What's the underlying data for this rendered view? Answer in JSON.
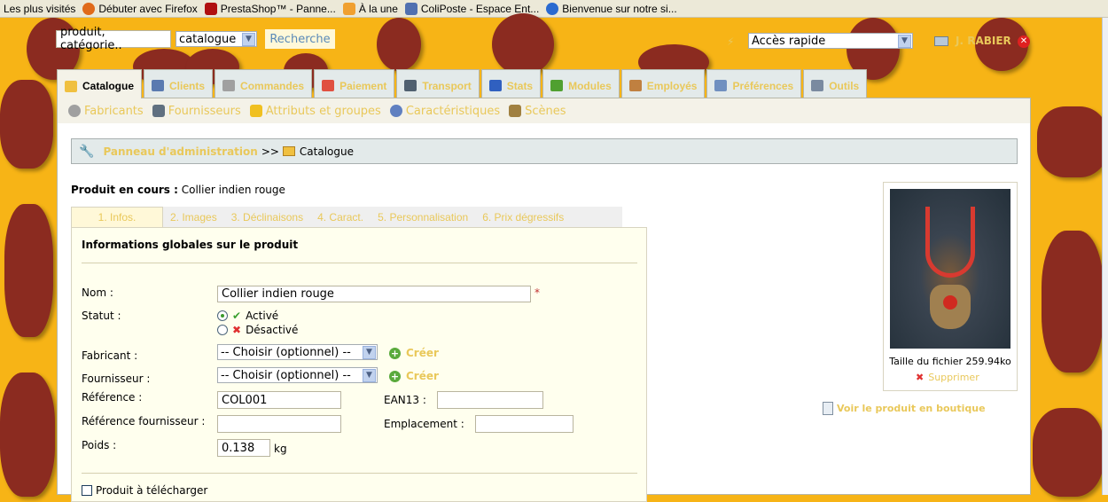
{
  "bookmarks": [
    {
      "label": "Les plus visités",
      "icon": "none"
    },
    {
      "label": "Débuter avec Firefox",
      "icon": "firefox-icon",
      "color": "#e06a1a"
    },
    {
      "label": "PrestaShop™ - Panne...",
      "icon": "prestashop-icon",
      "color": "#b01010"
    },
    {
      "label": "À la une",
      "icon": "rss-icon",
      "color": "#f0a030"
    },
    {
      "label": "ColiPoste - Espace Ent...",
      "icon": "coliposte-icon",
      "color": "#5070b0"
    },
    {
      "label": "Bienvenue sur notre si...",
      "icon": "site-icon",
      "color": "#2a6ad0"
    }
  ],
  "header": {
    "search_value": "produit, catégorie..",
    "search_scope": "catalogue",
    "search_button": "Recherche",
    "quick_access": "Accès rapide",
    "user": "J. RABIER"
  },
  "tabs": [
    {
      "label": "Catalogue",
      "active": true,
      "color": "#f0c040"
    },
    {
      "label": "Clients",
      "color": "#5a7ab0"
    },
    {
      "label": "Commandes",
      "color": "#a0a0a0"
    },
    {
      "label": "Paiement",
      "color": "#e05040"
    },
    {
      "label": "Transport",
      "color": "#506070"
    },
    {
      "label": "Stats",
      "color": "#3060c0"
    },
    {
      "label": "Modules",
      "color": "#50a030"
    },
    {
      "label": "Employés",
      "color": "#c08040"
    },
    {
      "label": "Préférences",
      "color": "#7090c0"
    },
    {
      "label": "Outils",
      "color": "#7a8aa0"
    }
  ],
  "subnav": [
    {
      "label": "Fabricants",
      "color": "#a0a0a0"
    },
    {
      "label": "Fournisseurs",
      "color": "#607080"
    },
    {
      "label": "Attributs et groupes",
      "color": "#f0c020"
    },
    {
      "label": "Caractéristiques",
      "color": "#6080c0"
    },
    {
      "label": "Scènes",
      "color": "#a08040"
    }
  ],
  "breadcrumb": {
    "root": "Panneau d'administration",
    "sep": ">>",
    "current": "Catalogue"
  },
  "product": {
    "current_label": "Produit en cours :",
    "current_name": "Collier indien rouge"
  },
  "product_tabs": [
    "1. Infos.",
    "2. Images",
    "3. Déclinaisons",
    "4. Caract.",
    "5. Personnalisation",
    "6. Prix dégressifs"
  ],
  "form": {
    "title": "Informations globales sur le produit",
    "name_label": "Nom :",
    "name_value": "Collier indien rouge",
    "required": "*",
    "status_label": "Statut :",
    "status_on": "Activé",
    "status_off": "Désactivé",
    "manufacturer_label": "Fabricant :",
    "manufacturer_value": "-- Choisir (optionnel) --",
    "supplier_label": "Fournisseur :",
    "supplier_value": "-- Choisir (optionnel) --",
    "create": "Créer",
    "reference_label": "Référence :",
    "reference_value": "COL001",
    "ean_label": "EAN13 :",
    "ean_value": "",
    "supplier_ref_label": "Référence fournisseur :",
    "supplier_ref_value": "",
    "location_label": "Emplacement :",
    "location_value": "",
    "weight_label": "Poids :",
    "weight_value": "0.138",
    "weight_unit": "kg",
    "downloadable_label": "Produit à télécharger"
  },
  "image_box": {
    "file_size": "Taille du fichier 259.94ko",
    "delete": "Supprimer",
    "view_in_shop": "Voir le produit en boutique"
  }
}
